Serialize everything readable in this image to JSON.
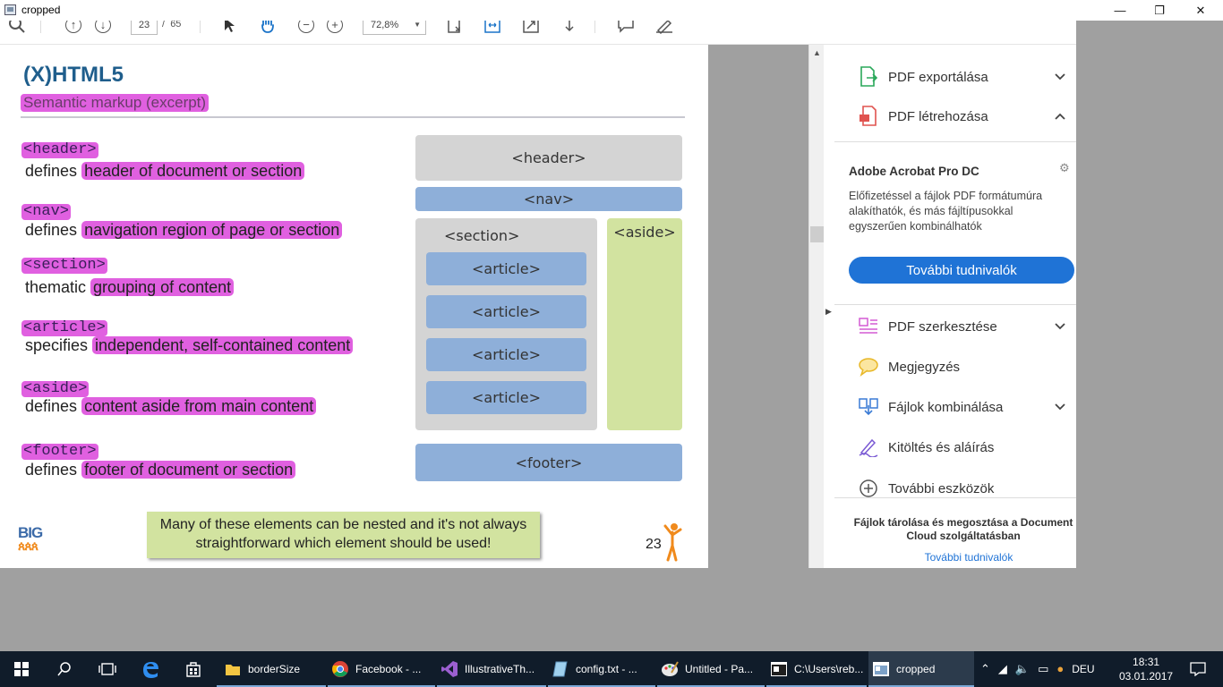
{
  "window": {
    "title": "cropped",
    "minimize": "—",
    "maximize": "❐",
    "close": "✕"
  },
  "toolbar": {
    "page_current": "23",
    "page_separator": "/",
    "page_total": "65",
    "zoom": "72,8%"
  },
  "slide": {
    "title": "(X)HTML5",
    "subtitle": "Semantic markup (excerpt)",
    "definitions": [
      {
        "tag": "<header>",
        "prefix": "defines",
        "highlight": "header of document or section"
      },
      {
        "tag": "<nav>",
        "prefix": "defines",
        "highlight": "navigation region of page or section"
      },
      {
        "tag": "<section>",
        "prefix": "thematic",
        "highlight": "grouping of content"
      },
      {
        "tag": "<article>",
        "prefix": "specifies",
        "highlight": "independent, self-contained content"
      },
      {
        "tag": "<aside>",
        "prefix": "defines",
        "highlight": "content aside from main content"
      },
      {
        "tag": "<footer>",
        "prefix": "defines",
        "highlight": "footer of document or section"
      }
    ],
    "diagram": {
      "header": "<header>",
      "nav": "<nav>",
      "section": "<section>",
      "articles": [
        "<article>",
        "<article>",
        "<article>",
        "<article>"
      ],
      "aside": "<aside>",
      "footer": "<footer>"
    },
    "note": "Many of these elements can be nested and it's not always straightforward which element should be used!",
    "page_number": "23",
    "logo_text": "BIG"
  },
  "right_pane": {
    "tools_top": [
      {
        "label": "PDF exportálása",
        "icon": "export-pdf-icon",
        "chevron": "⌄"
      },
      {
        "label": "PDF létrehozása",
        "icon": "create-pdf-icon",
        "chevron": "⌃"
      }
    ],
    "promo": {
      "title": "Adobe Acrobat Pro DC",
      "text": "Előfizetéssel a fájlok PDF formátumúra alakíthatók, és más fájltípusokkal egyszerűen kombinálhatók",
      "button": "További tudnivalók"
    },
    "tools_bottom": [
      {
        "label": "PDF szerkesztése",
        "icon": "edit-pdf-icon",
        "chevron": "⌄"
      },
      {
        "label": "Megjegyzés",
        "icon": "comment-icon",
        "chevron": ""
      },
      {
        "label": "Fájlok kombinálása",
        "icon": "combine-files-icon",
        "chevron": "⌄"
      },
      {
        "label": "Kitöltés és aláírás",
        "icon": "fill-sign-icon",
        "chevron": ""
      },
      {
        "label": "További eszközök",
        "icon": "more-tools-icon",
        "chevron": ""
      }
    ],
    "storage_text": "Fájlok tárolása és megosztása a Document Cloud szolgáltatásban",
    "storage_link": "További tudnivalók"
  },
  "taskbar": {
    "apps": [
      {
        "label": "borderSize",
        "icon": "folder-icon"
      },
      {
        "label": "Facebook - ...",
        "icon": "chrome-icon"
      },
      {
        "label": "IllustrativeTh...",
        "icon": "visual-studio-icon"
      },
      {
        "label": "config.txt - ...",
        "icon": "notepad-icon"
      },
      {
        "label": "Untitled - Pa...",
        "icon": "paint-icon"
      },
      {
        "label": "C:\\Users\\reb...",
        "icon": "console-icon"
      },
      {
        "label": "cropped",
        "icon": "image-viewer-icon"
      }
    ],
    "language": "DEU",
    "time": "18:31",
    "date": "03.01.2017"
  },
  "colors": {
    "highlight": "#e060e0",
    "title_blue": "#1f5e8c",
    "block_gray": "#d4d4d4",
    "block_blue": "#8eafd9",
    "block_green": "#d2e3a0",
    "acrobat_button": "#1f73d6",
    "taskbar": "#101c2a"
  }
}
